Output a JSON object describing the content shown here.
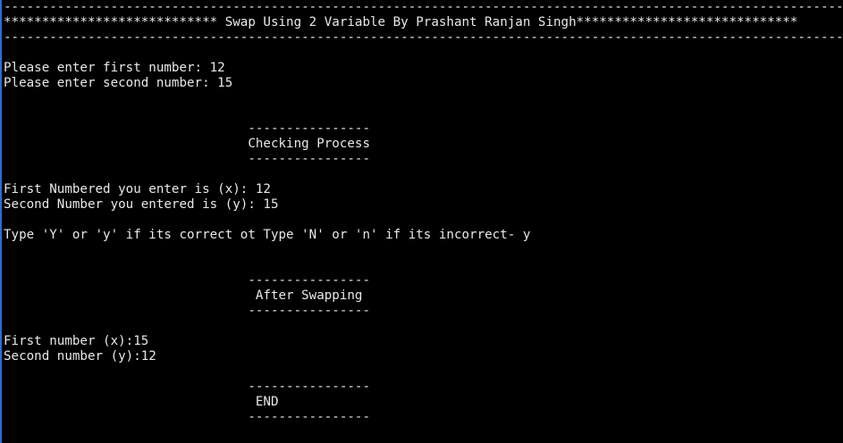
{
  "colors": {
    "background": "#000000",
    "text": "#e8e8e8",
    "left_border": "#2a6fd6"
  },
  "console": {
    "top_rule": "-----------------------------------------------------------------------------------------------------------------------",
    "title": "**************************** Swap Using 2 Variable By Prashant Ranjan Singh*****************************",
    "title_rule": "-----------------------------------------------------------------------------------------------------------------------",
    "prompt_first": "Please enter first number: 12",
    "prompt_second": "Please enter second number: 15",
    "checking_rule_top": "                                ----------------",
    "checking_heading": "                                Checking Process",
    "checking_rule_bottom": "                                ----------------",
    "entered_first": "First Numbered you enter is (x): 12",
    "entered_second": "Second Number you entered is (y): 15",
    "confirm_prompt": "Type 'Y' or 'y' if its correct ot Type 'N' or 'n' if its incorrect- y",
    "after_rule_top": "                                ----------------",
    "after_heading": "                                 After Swapping",
    "after_rule_bottom": "                                ----------------",
    "result_first": "First number (x):15",
    "result_second": "Second number (y):12",
    "end_rule_top": "                                ----------------",
    "end_heading": "                                 END",
    "end_rule_bottom": "                                ----------------"
  }
}
